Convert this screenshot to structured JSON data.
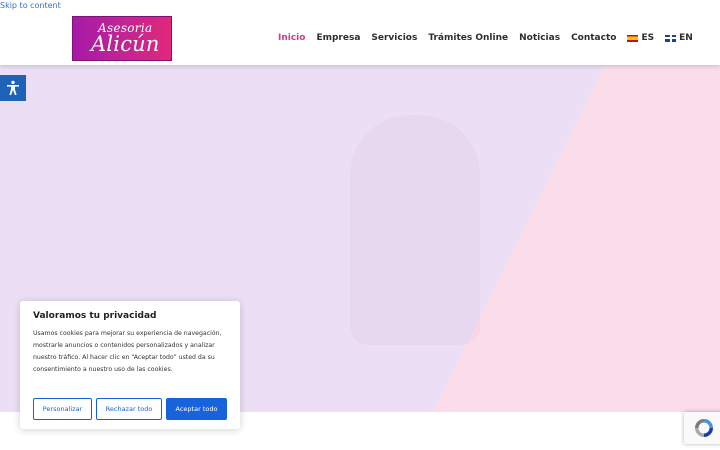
{
  "skip_link": "Skip to content",
  "logo": {
    "top": "Asesoria",
    "bottom": "Alicún"
  },
  "nav": {
    "items": [
      {
        "label": "Inicio",
        "active": true
      },
      {
        "label": "Empresa"
      },
      {
        "label": "Servicios"
      },
      {
        "label": "Trámites Online"
      },
      {
        "label": "Noticias"
      },
      {
        "label": "Contacto"
      }
    ],
    "lang_es": "ES",
    "lang_en": "EN"
  },
  "colors": {
    "active_nav": "#d43a8c",
    "primary_blue": "#1863dc",
    "hero_lavender": "#ecdff5",
    "hero_pink": "#fbdde9"
  },
  "icons": {
    "accessibility": "accessibility-icon",
    "recaptcha": "recaptcha-icon"
  },
  "cookie": {
    "title": "Valoramos tu privacidad",
    "text": "Usamos cookies para mejorar su experiencia de navegación, mostrarle anuncios o contenidos personalizados y analizar nuestro tráfico. Al hacer clic en “Aceptar todo” usted da su consentimiento a nuestro uso de las cookies.",
    "customize": "Personalizar",
    "reject": "Rechazar todo",
    "accept": "Aceptar todo"
  }
}
